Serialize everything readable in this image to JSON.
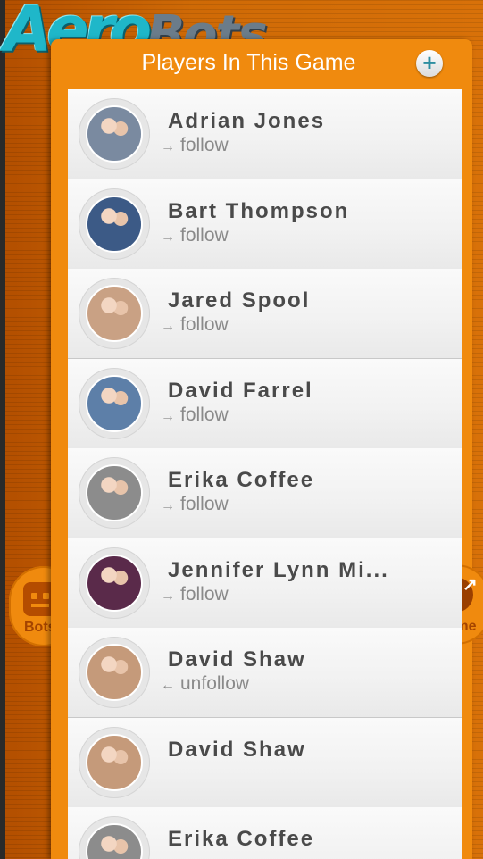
{
  "app": {
    "logo_text": "Aero",
    "logo_text2": "Bots"
  },
  "header": {
    "title": "Players In This Game",
    "add_icon": "plus-icon"
  },
  "side_tabs": {
    "left_label": "Bots",
    "right_label": "Game"
  },
  "players": [
    {
      "name": "Adrian Jones",
      "action": "follow",
      "arrow": "→",
      "avatar": "#7a8aa0"
    },
    {
      "name": "Bart Thompson",
      "action": "follow",
      "arrow": "→",
      "avatar": "#3c5a86"
    },
    {
      "name": "Jared Spool",
      "action": "follow",
      "arrow": "→",
      "avatar": "#c9a184"
    },
    {
      "name": "David Farrel",
      "action": "follow",
      "arrow": "→",
      "avatar": "#5d7fa8"
    },
    {
      "name": "Erika Coffee",
      "action": "follow",
      "arrow": "→",
      "avatar": "#8c8c8c"
    },
    {
      "name": "Jennifer Lynn Mi...",
      "action": "follow",
      "arrow": "→",
      "avatar": "#5a2a4a"
    },
    {
      "name": "David Shaw",
      "action": "unfollow",
      "arrow": "←",
      "avatar": "#c59a7a"
    },
    {
      "name": "David Shaw",
      "action": "",
      "arrow": "",
      "avatar": "#c59a7a"
    },
    {
      "name": "Erika Coffee",
      "action": "",
      "arrow": "",
      "avatar": "#8c8c8c"
    }
  ],
  "colors": {
    "accent": "#f08a0e",
    "add_icon": "#2e8ea0"
  }
}
